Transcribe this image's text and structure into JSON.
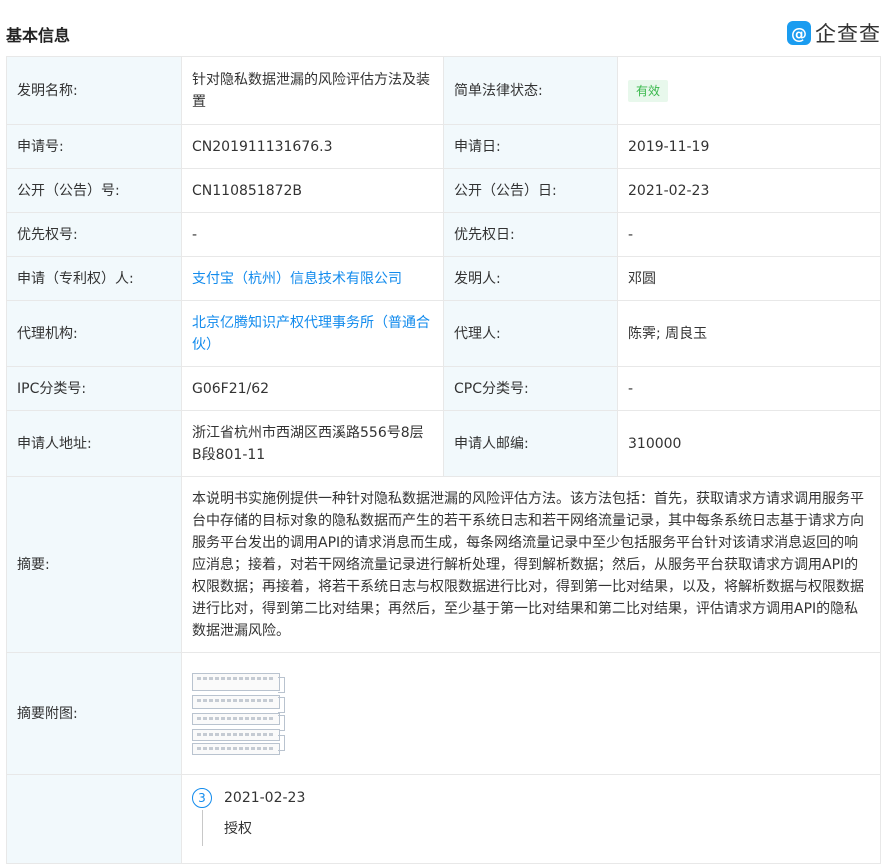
{
  "header": {
    "title": "基本信息",
    "brand_icon": "@",
    "brand_name": "企查查"
  },
  "rows": {
    "invention_name": {
      "label": "发明名称:",
      "value": "针对隐私数据泄漏的风险评估方法及装置"
    },
    "legal_status": {
      "label": "简单法律状态:",
      "value": "有效"
    },
    "app_no": {
      "label": "申请号:",
      "value": "CN201911131676.3"
    },
    "app_date": {
      "label": "申请日:",
      "value": "2019-11-19"
    },
    "pub_no": {
      "label": "公开（公告）号:",
      "value": "CN110851872B"
    },
    "pub_date": {
      "label": "公开（公告）日:",
      "value": "2021-02-23"
    },
    "priority_no": {
      "label": "优先权号:",
      "value": "-"
    },
    "priority_date": {
      "label": "优先权日:",
      "value": "-"
    },
    "applicant": {
      "label": "申请（专利权）人:",
      "value": "支付宝（杭州）信息技术有限公司"
    },
    "inventor": {
      "label": "发明人:",
      "value": "邓圆"
    },
    "agency": {
      "label": "代理机构:",
      "value": "北京亿腾知识产权代理事务所（普通合伙）"
    },
    "agent": {
      "label": "代理人:",
      "value": "陈霁; 周良玉"
    },
    "ipc": {
      "label": "IPC分类号:",
      "value": "G06F21/62"
    },
    "cpc": {
      "label": "CPC分类号:",
      "value": "-"
    },
    "address": {
      "label": "申请人地址:",
      "value": "浙江省杭州市西湖区西溪路556号8层B段801-11"
    },
    "postcode": {
      "label": "申请人邮编:",
      "value": "310000"
    },
    "abstract": {
      "label": "摘要:",
      "value": "本说明书实施例提供一种针对隐私数据泄漏的风险评估方法。该方法包括：首先，获取请求方请求调用服务平台中存储的目标对象的隐私数据而产生的若干系统日志和若干网络流量记录，其中每条系统日志基于请求方向服务平台发出的调用API的请求消息而生成，每条网络流量记录中至少包括服务平台针对该请求消息返回的响应消息；接着，对若干网络流量记录进行解析处理，得到解析数据；然后，从服务平台获取请求方调用API的权限数据；再接着，将若干系统日志与权限数据进行比对，得到第一比对结果，以及，将解析数据与权限数据进行比对，得到第二比对结果；再然后，至少基于第一比对结果和第二比对结果，评估请求方调用API的隐私数据泄漏风险。"
    },
    "abstract_figure": {
      "label": "摘要附图:"
    }
  },
  "timeline": {
    "step": "3",
    "date": "2021-02-23",
    "event": "授权"
  },
  "colors": {
    "label_bg": "#f2f9fc",
    "link": "#128bed",
    "badge_bg": "#e8f8ec",
    "badge_text": "#39b84c"
  }
}
